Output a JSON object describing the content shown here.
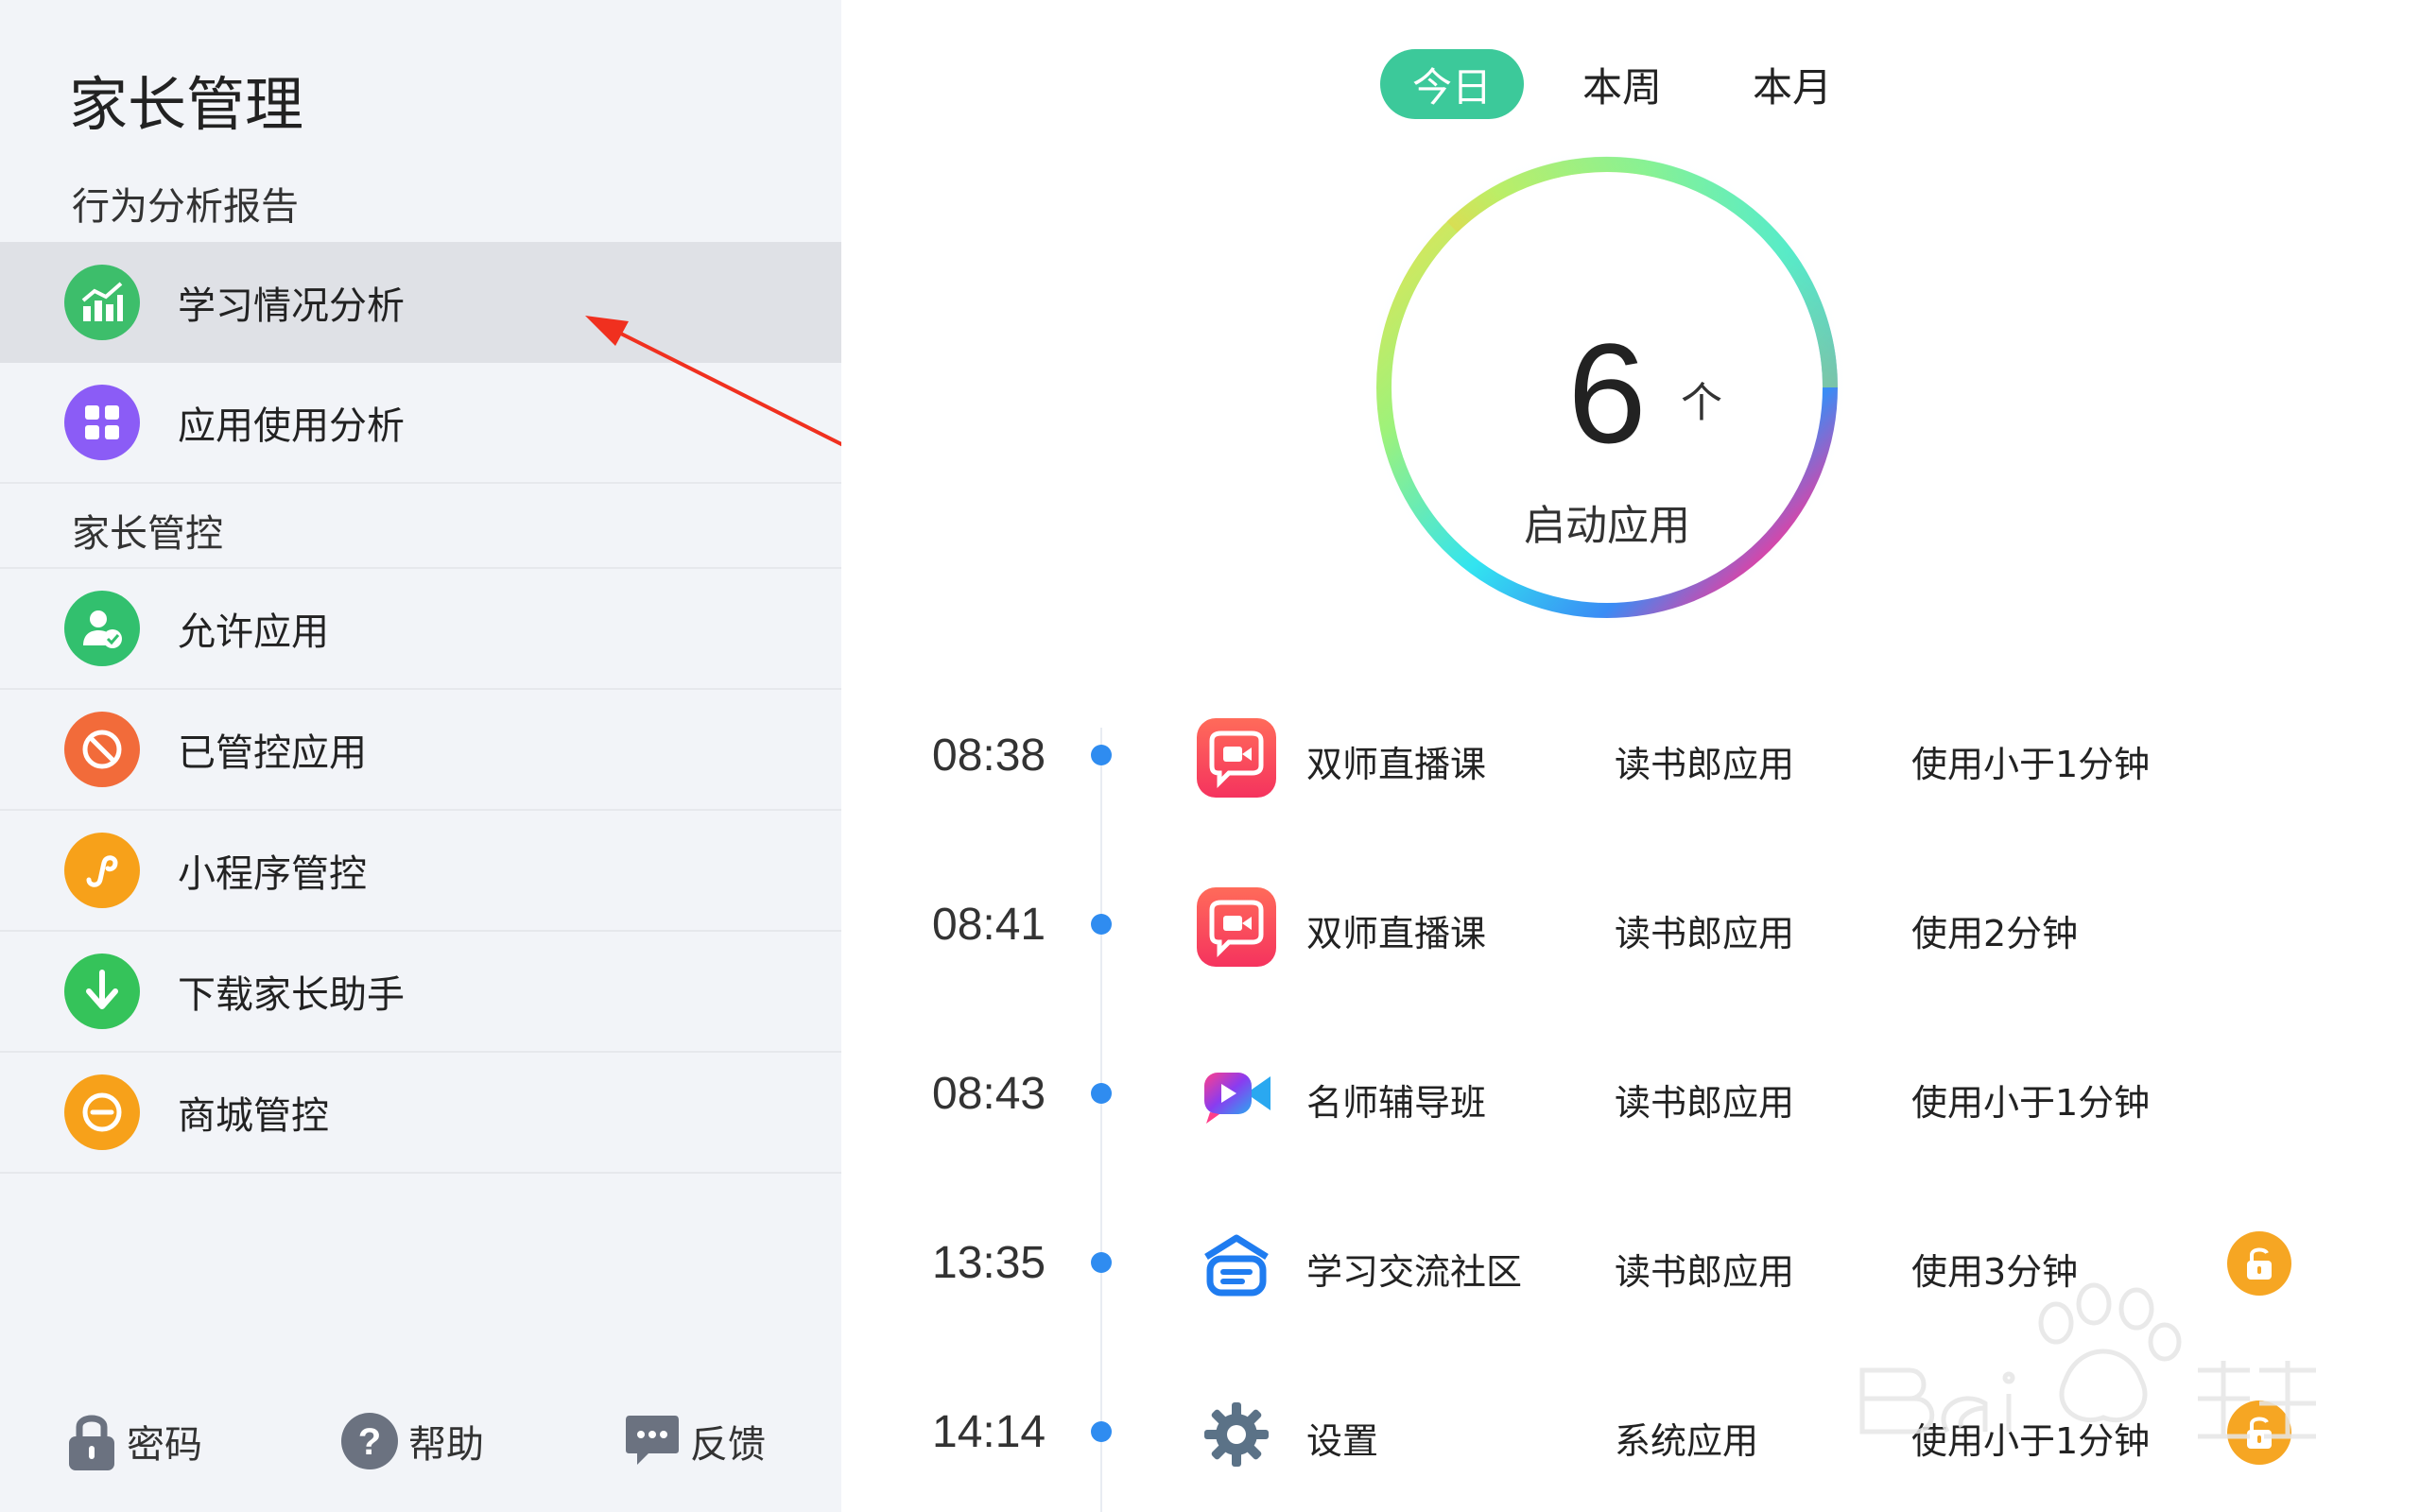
{
  "sidebar": {
    "title": "家长管理",
    "section1": "行为分析报告",
    "items1": [
      {
        "label": "学习情况分析",
        "color": "#3dbe6b",
        "icon": "chart-icon"
      },
      {
        "label": "应用使用分析",
        "color": "#8b5cf6",
        "icon": "grid-icon"
      }
    ],
    "section2": "家长管控",
    "items2": [
      {
        "label": "允许应用",
        "color": "#32c06e",
        "icon": "user-check-icon"
      },
      {
        "label": "已管控应用",
        "color": "#f26b3a",
        "icon": "ban-icon"
      },
      {
        "label": "小程序管控",
        "color": "#f7a11a",
        "icon": "mini-program-icon"
      },
      {
        "label": "下载家长助手",
        "color": "#35c35a",
        "icon": "download-icon"
      },
      {
        "label": "商城管控",
        "color": "#f7a11a",
        "icon": "minus-circle-icon"
      }
    ],
    "footer": {
      "password": "密码",
      "help": "帮助",
      "feedback": "反馈"
    }
  },
  "main": {
    "tabs": [
      "今日",
      "本周",
      "本月"
    ],
    "active_tab": 0,
    "summary": {
      "count": "6",
      "unit": "个",
      "label": "启动应用"
    },
    "records": [
      {
        "time": "08:38",
        "name": "双师直播课",
        "type": "读书郎应用",
        "usage": "使用小于1分钟",
        "icon": "live-class-icon",
        "locked": false
      },
      {
        "time": "08:41",
        "name": "双师直播课",
        "type": "读书郎应用",
        "usage": "使用2分钟",
        "icon": "live-class-icon",
        "locked": false
      },
      {
        "time": "08:43",
        "name": "名师辅导班",
        "type": "读书郎应用",
        "usage": "使用小于1分钟",
        "icon": "video-camera-icon",
        "locked": false
      },
      {
        "time": "13:35",
        "name": "学习交流社区",
        "type": "读书郎应用",
        "usage": "使用3分钟",
        "icon": "community-icon",
        "locked": true
      },
      {
        "time": "14:14",
        "name": "设置",
        "type": "系统应用",
        "usage": "使用小于1分钟",
        "icon": "gear-icon",
        "locked": true
      }
    ]
  },
  "colors": {
    "accent": "#3cc99a",
    "timeline_dot": "#2f8cf0",
    "lock": "#f6a623"
  }
}
